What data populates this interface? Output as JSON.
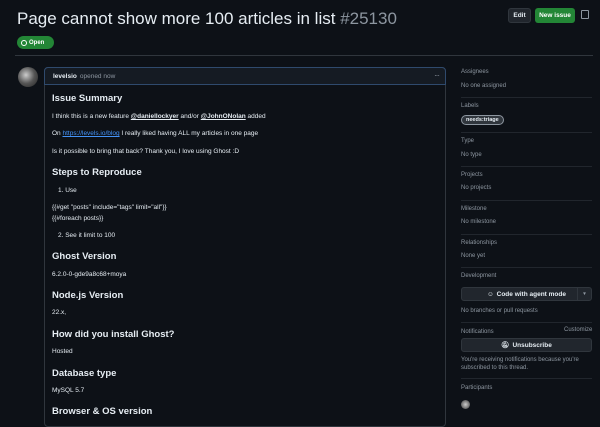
{
  "header": {
    "title": "Page cannot show more 100 articles in list",
    "number": "#25130",
    "edit": "Edit",
    "new_issue": "New issue",
    "status": "Open"
  },
  "comment": {
    "author": "levelsio",
    "action": "opened now",
    "menu": "···"
  },
  "body": {
    "h_summary": "Issue Summary",
    "p1_a": "I think this is a new feature",
    "mention1": "@daniellockyer",
    "p1_b": "and/or",
    "mention2": "@JohnONolan",
    "p1_c": "added",
    "p2_a": "On",
    "link": "https://levels.io/blog",
    "p2_b": "I really liked having ALL my articles in one page",
    "p3": "Is it possible to bring that back? Thank you, I love using Ghost :D",
    "h_steps": "Steps to Reproduce",
    "step1": "1. Use",
    "code1": "{{#get \"posts\" include=\"tags\" limit=\"all\"}}",
    "code2": "{{#foreach posts}}",
    "step2": "2. See it limit to 100",
    "h_ghost": "Ghost Version",
    "ghost": "6.2.0-0-gde9a8c68+moya",
    "h_node": "Node.js Version",
    "node": "22.x,",
    "h_install": "How did you install Ghost?",
    "install": "Hosted",
    "h_db": "Database type",
    "db": "MySQL 5.7",
    "h_browser": "Browser & OS version"
  },
  "sidebar": {
    "assignees": "Assignees",
    "assignees_v": "No one assigned",
    "labels": "Labels",
    "label": "needs:triage",
    "type": "Type",
    "type_v": "No type",
    "projects": "Projects",
    "projects_v": "No projects",
    "milestone": "Milestone",
    "milestone_v": "No milestone",
    "relationships": "Relationships",
    "relationships_v": "None yet",
    "development": "Development",
    "code_agent": "Code with agent mode",
    "dev_v": "No branches or pull requests",
    "notifications": "Notifications",
    "customize": "Customize",
    "unsubscribe": "Unsubscribe",
    "notif_v1": "You're receiving notifications because you're",
    "notif_v2": "subscribed to this thread.",
    "participants": "Participants"
  }
}
